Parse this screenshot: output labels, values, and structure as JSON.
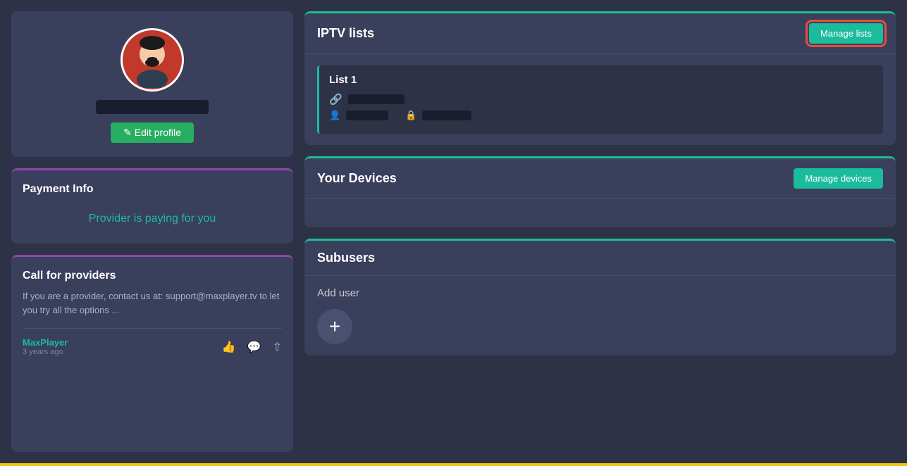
{
  "left": {
    "profile": {
      "username_placeholder": "redacted",
      "edit_button_label": "✎ Edit profile"
    },
    "payment": {
      "title": "Payment Info",
      "provider_paying_text": "Provider is paying for you"
    },
    "call_providers": {
      "title": "Call for providers",
      "description": "If you are a provider, contact us at: support@maxplayer.tv to let you try all the options ...",
      "author_name": "MaxPlayer",
      "author_time": "3 years ago"
    }
  },
  "right": {
    "iptv": {
      "section_title": "IPTV lists",
      "manage_button_label": "Manage lists",
      "list": {
        "name": "List 1",
        "url_redacted_width": 80,
        "user_redacted_width": 60,
        "pass_redacted_width": 70
      }
    },
    "devices": {
      "section_title": "Your Devices",
      "manage_button_label": "Manage devices"
    },
    "subusers": {
      "section_title": "Subusers",
      "add_user_label": "Add user",
      "add_user_icon": "+"
    }
  }
}
